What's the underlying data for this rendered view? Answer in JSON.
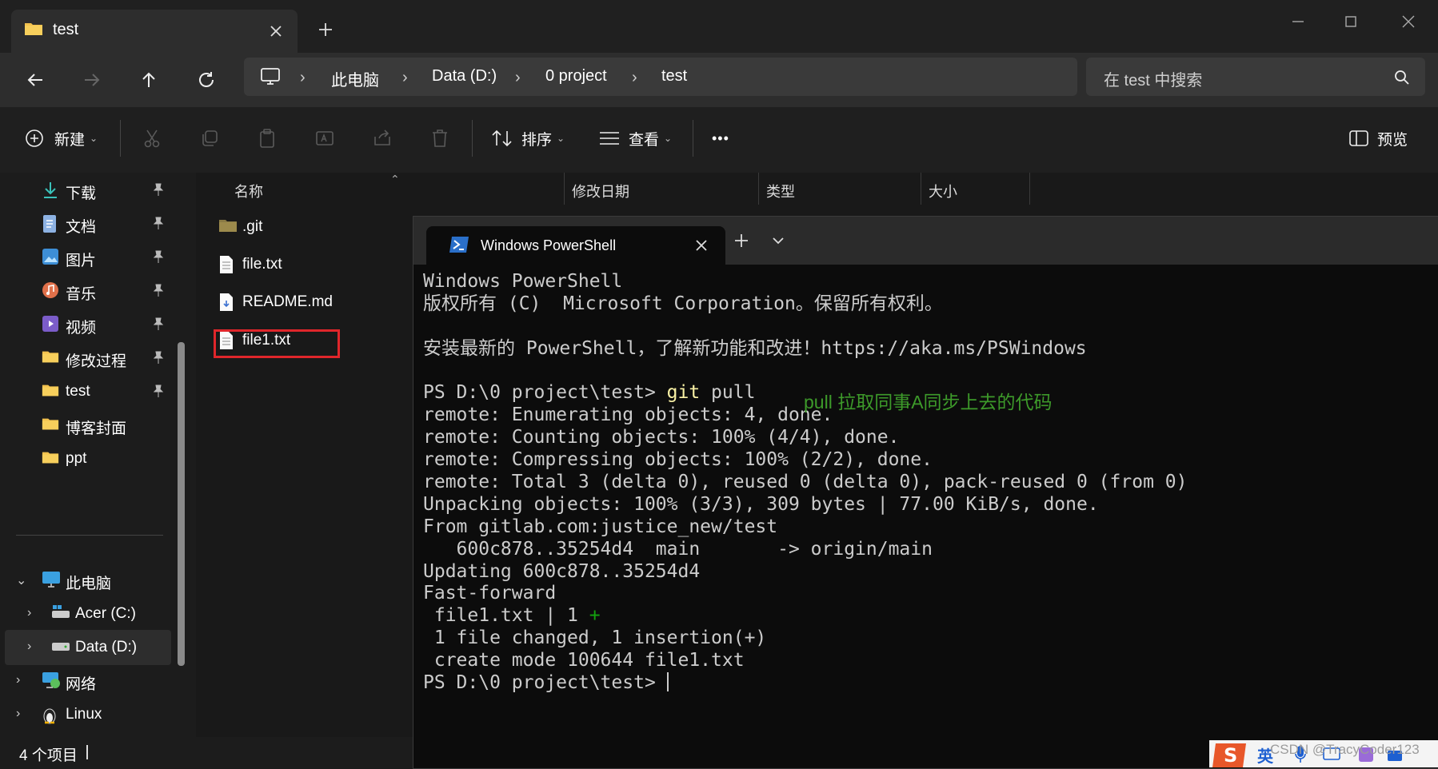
{
  "window": {
    "tab_title": "test",
    "new_tab_symbol": "+",
    "close_symbol": "✕"
  },
  "nav": {
    "breadcrumb": [
      "此电脑",
      "Data (D:)",
      "0 project",
      "test"
    ],
    "search_placeholder": "在 test 中搜索"
  },
  "toolbar": {
    "new_label": "新建",
    "sort_label": "排序",
    "view_label": "查看",
    "more_label": "•••",
    "preview_label": "预览"
  },
  "sidebar": {
    "quick_access": [
      {
        "label": "下载",
        "icon": "download-icon"
      },
      {
        "label": "文档",
        "icon": "document-icon"
      },
      {
        "label": "图片",
        "icon": "pictures-icon"
      },
      {
        "label": "音乐",
        "icon": "music-icon"
      },
      {
        "label": "视频",
        "icon": "video-icon"
      },
      {
        "label": "修改过程",
        "icon": "folder-icon"
      },
      {
        "label": "test",
        "icon": "folder-icon"
      },
      {
        "label": "博客封面",
        "icon": "folder-icon"
      },
      {
        "label": "ppt",
        "icon": "folder-icon"
      }
    ],
    "this_pc": "此电脑",
    "drives": [
      "Acer (C:)",
      "Data (D:)"
    ],
    "network": "网络",
    "linux": "Linux"
  },
  "filelist": {
    "columns": [
      "名称",
      "修改日期",
      "类型",
      "大小"
    ],
    "files": [
      {
        "name": ".git",
        "icon": "folder-icon"
      },
      {
        "name": "file.txt",
        "icon": "text-file-icon"
      },
      {
        "name": "README.md",
        "icon": "markdown-file-icon"
      },
      {
        "name": "file1.txt",
        "icon": "text-file-icon"
      }
    ]
  },
  "status": {
    "item_count": "4 个项目"
  },
  "powershell": {
    "tab_title": "Windows PowerShell",
    "lines": [
      "Windows PowerShell",
      "版权所有 (C)  Microsoft Corporation。保留所有权利。",
      "",
      "安装最新的 PowerShell，了解新功能和改进！https://aka.ms/PSWindows",
      "",
      "__PROMPT_GIT__",
      "remote: Enumerating objects: 4, done.",
      "remote: Counting objects: 100% (4/4), done.",
      "remote: Compressing objects: 100% (2/2), done.",
      "remote: Total 3 (delta 0), reused 0 (delta 0), pack-reused 0 (from 0)",
      "Unpacking objects: 100% (3/3), 309 bytes | 77.00 KiB/s, done.",
      "From gitlab.com:justice_new/test",
      "   600c878..35254d4  main       -> origin/main",
      "Updating 600c878..35254d4",
      "Fast-forward",
      "__DIFFSTAT__",
      " 1 file changed, 1 insertion(+)",
      " create mode 100644 file1.txt",
      "__PROMPT_END__"
    ],
    "prompt": "PS D:\\0 project\\test> ",
    "git_word": "git",
    "git_args": " pull",
    "diffstat_prefix": " file1.txt | 1 ",
    "diffstat_plus": "+",
    "annotation": "pull 拉取同事A同步上去的代码"
  },
  "ime": {
    "lang": "英"
  },
  "watermark": "CSDN @TracyCoder123",
  "colors": {
    "accent_red": "#e0262b",
    "annotation_green": "#3d9a2a",
    "diff_plus_green": "#13a10e",
    "git_yellow": "#f9f1a5"
  }
}
